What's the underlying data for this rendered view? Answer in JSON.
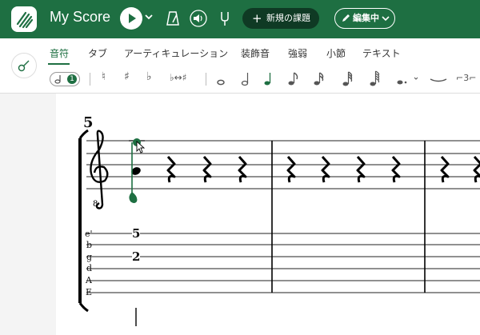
{
  "app": {
    "title": "My Score"
  },
  "header": {
    "new_task_label": "新規の課題",
    "edit_label": "編集中"
  },
  "tabs": [
    {
      "label": "音符",
      "active": true
    },
    {
      "label": "タブ"
    },
    {
      "label": "アーティキュレーション"
    },
    {
      "label": "装飾音"
    },
    {
      "label": "強弱"
    },
    {
      "label": "小節"
    },
    {
      "label": "テキスト"
    }
  ],
  "toolbar": {
    "voice_number": "1",
    "natural": "♮",
    "sharp": "♯",
    "flat": "♭",
    "enharmonic": "♭↔♯",
    "dotted_dd": "•",
    "tuplet": "⌐3⌐",
    "selected_duration": "quarter"
  },
  "score": {
    "measure_number": "5",
    "tab_strings": [
      "e'",
      "b",
      "g",
      "d",
      "A",
      "E"
    ],
    "frets": [
      {
        "string": "e'",
        "fret": "5"
      },
      {
        "string": "g",
        "fret": "2"
      }
    ]
  },
  "colors": {
    "brand": "#1e6f42",
    "brand_dark": "#0f3a24"
  },
  "icons": {
    "logo": "app-logo-icon",
    "play": "play-icon",
    "metronome": "metronome-icon",
    "volume": "speaker-icon",
    "tuning": "tuning-fork-icon",
    "guitar": "guitar-icon"
  }
}
